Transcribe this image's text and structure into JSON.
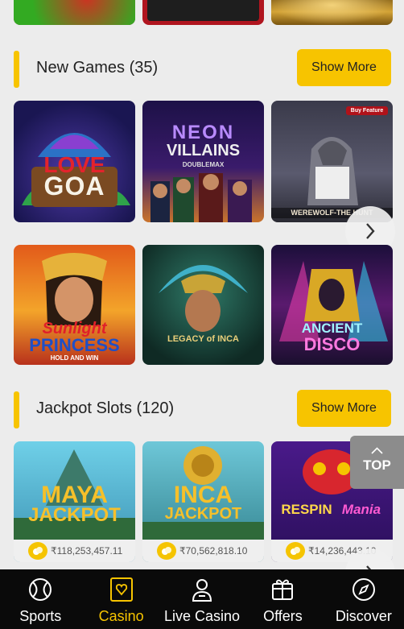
{
  "sections": {
    "new_games": {
      "title": "New Games (35)",
      "show_more": "Show More"
    },
    "jackpot_slots": {
      "title": "Jackpot Slots (120)",
      "show_more": "Show More"
    }
  },
  "games": {
    "love_goa": {
      "title1": "LOVE",
      "title2": "GOA"
    },
    "neon_villains": {
      "title1": "NEON",
      "title2": "VILLAINS",
      "sub": "DOUBLEMAX"
    },
    "werewolf": {
      "badge": "Buy Feature",
      "title": "WEREWOLF-THE HUNT"
    },
    "sunlight_princess": {
      "title1": "Sunlight",
      "title2": "PRINCESS",
      "sub": "HOLD AND WIN"
    },
    "legacy_inca": {
      "title": "LEGACY of INCA"
    },
    "ancient_disco": {
      "title1": "ANCIENT",
      "title2": "DISCO"
    },
    "maya_jackpot": {
      "title1": "MAYA",
      "title2": "JACKPOT",
      "amount": "₹118,253,457.11"
    },
    "inca_jackpot": {
      "title1": "INCA",
      "title2": "JACKPOT",
      "amount": "₹70,562,818.10"
    },
    "respin_mania": {
      "title1": "RESPIN",
      "title2": "Mania",
      "amount": "₹14,236,443.10"
    }
  },
  "top_button": "TOP",
  "bottom_nav": [
    {
      "label": "Sports",
      "icon": "sports-ball-icon"
    },
    {
      "label": "Casino",
      "icon": "casino-cards-icon",
      "active": true
    },
    {
      "label": "Live Casino",
      "icon": "live-dealer-icon"
    },
    {
      "label": "Offers",
      "icon": "offers-icon"
    },
    {
      "label": "Discover",
      "icon": "compass-icon"
    }
  ],
  "colors": {
    "accent": "#f7c400",
    "nav_bg": "#0a0a0a",
    "page_bg": "#ececec"
  }
}
